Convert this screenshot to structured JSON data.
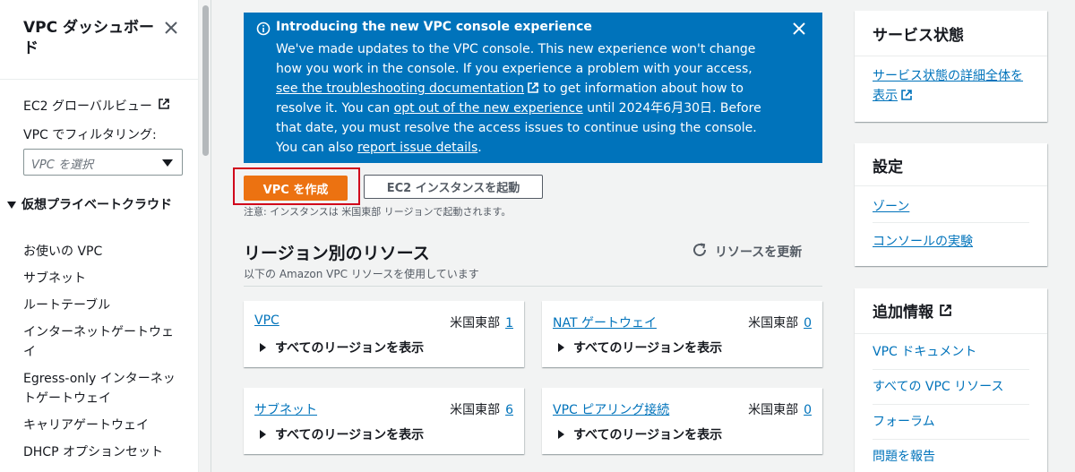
{
  "sidebar": {
    "title": "VPC ダッシュボード",
    "ec2_global_view": "EC2 グローバルビュー",
    "filter_label": "VPC でフィルタリング:",
    "filter_placeholder": "VPC を選択",
    "section": "仮想プライベートクラウド",
    "items": [
      "お使いの VPC",
      "サブネット",
      "ルートテーブル",
      "インターネットゲートウェイ",
      "Egress-only インターネットゲートウェイ",
      "キャリアゲートウェイ",
      "DHCP オプションセット"
    ]
  },
  "banner": {
    "title": "Introducing the new VPC console experience",
    "body_1": "We've made updates to the VPC console. This new experience won't change how you work in the console. If you experience a problem with your access, ",
    "link_1": "see the troubleshooting documentation",
    "body_2": " to get information about how to resolve it. You can ",
    "link_2": "opt out of the new experience",
    "body_3": " until 2024年6月30日. Before that date, you must resolve the access issues to continue using the console. You can also ",
    "link_3": "report issue details",
    "body_4": "."
  },
  "actions": {
    "create_vpc": "VPC を作成",
    "launch_ec2": "EC2 インスタンスを起動",
    "note": "注意: インスタンスは 米国東部 リージョンで起動されます。"
  },
  "resources": {
    "title": "リージョン別のリソース",
    "subtitle": "以下の Amazon VPC リソースを使用しています",
    "refresh": "リソースを更新",
    "cards": [
      {
        "name": "VPC",
        "region": "米国東部",
        "count": "1",
        "expand": "すべてのリージョンを表示"
      },
      {
        "name": "NAT ゲートウェイ",
        "region": "米国東部",
        "count": "0",
        "expand": "すべてのリージョンを表示"
      },
      {
        "name": "サブネット",
        "region": "米国東部",
        "count": "6",
        "expand": "すべてのリージョンを表示"
      },
      {
        "name": "VPC ピアリング接続",
        "region": "米国東部",
        "count": "0",
        "expand": "すべてのリージョンを表示"
      }
    ]
  },
  "service_health": {
    "title": "サービス状態",
    "link": "サービス状態の詳細全体を表示"
  },
  "settings": {
    "title": "設定",
    "links": [
      "ゾーン",
      "コンソールの実験"
    ]
  },
  "additional_info": {
    "title": "追加情報",
    "links": [
      "VPC ドキュメント",
      "すべての VPC リソース",
      "フォーラム",
      "問題を報告"
    ]
  },
  "colors": {
    "primary": "#ec7211",
    "banner": "#0073bb",
    "link": "#0073bb",
    "highlight": "#d0021b"
  }
}
